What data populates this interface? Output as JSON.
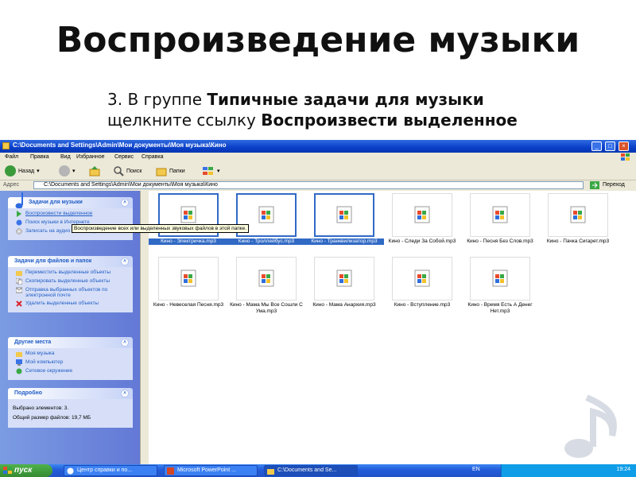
{
  "slide": {
    "title": "Воспроизведение музыки",
    "step_prefix": "3. В группе ",
    "step_bold1": "Типичные задачи для музыки",
    "step_mid": " щелкните ссылку ",
    "step_bold2": "Воспроизвести выделенное"
  },
  "window": {
    "title": "C:\\Documents and Settings\\Admin\\Мои документы\\Моя музыка\\Кино"
  },
  "menubar": [
    "Файл",
    "Правка",
    "Вид",
    "Избранное",
    "Сервис",
    "Справка"
  ],
  "toolbar": {
    "back": "Назад",
    "search": "Поиск",
    "folders": "Папки"
  },
  "address": {
    "label": "Адрес",
    "value": "C:\\Documents and Settings\\Admin\\Мои документы\\Моя музыка\\Кино",
    "go": "Переход"
  },
  "panels": {
    "music_tasks": {
      "title": "Задачи для музыки",
      "items": [
        "Воспроизвести выделенное",
        "Поиск музыки в Интернете",
        "Записать на аудио компакт-диск"
      ]
    },
    "file_tasks": {
      "title": "Задачи для файлов и папок",
      "items": [
        "Переместить выделенные объекты",
        "Скопировать выделенные объекты",
        "Отправка выбранных объектов по электронной почте",
        "Удалить выделенные объекты"
      ]
    },
    "other_places": {
      "title": "Другие места",
      "items": [
        "Моя музыка",
        "Мой компьютер",
        "Сетевое окружение"
      ]
    },
    "details": {
      "title": "Подробно",
      "selected": "Выбрано элементов: 3.",
      "total": "Общий размер файлов: 19,7 МБ"
    }
  },
  "tooltip": "Воспроизведение всех или выделенных звуковых файлов в этой папке.",
  "files": [
    {
      "name": "Кино - Электричка.mp3",
      "selected": true
    },
    {
      "name": "Кино - Троллейбус.mp3",
      "selected": true
    },
    {
      "name": "Кино - Транквилизатор.mp3",
      "selected": true
    },
    {
      "name": "Кино - Следи За Собой.mp3",
      "selected": false
    },
    {
      "name": "Кино - Песня Без Слов.mp3",
      "selected": false
    },
    {
      "name": "Кино - Пачка Сигарет.mp3",
      "selected": false
    },
    {
      "name": "Кино - Невеселая Песня.mp3",
      "selected": false
    },
    {
      "name": "Кино - Мама Мы Все Сошли С Ума.mp3",
      "selected": false
    },
    {
      "name": "Кино - Мама Анархия.mp3",
      "selected": false
    },
    {
      "name": "Кино - Вступление.mp3",
      "selected": false
    },
    {
      "name": "Кино - Время Есть А Денег Нет.mp3",
      "selected": false
    }
  ],
  "taskbar": {
    "start": "пуск",
    "tasks": [
      "Центр справки и по...",
      "Microsoft PowerPoint ...",
      "C:\\Documents and Se..."
    ],
    "lang": "EN",
    "clock": "19:24"
  }
}
